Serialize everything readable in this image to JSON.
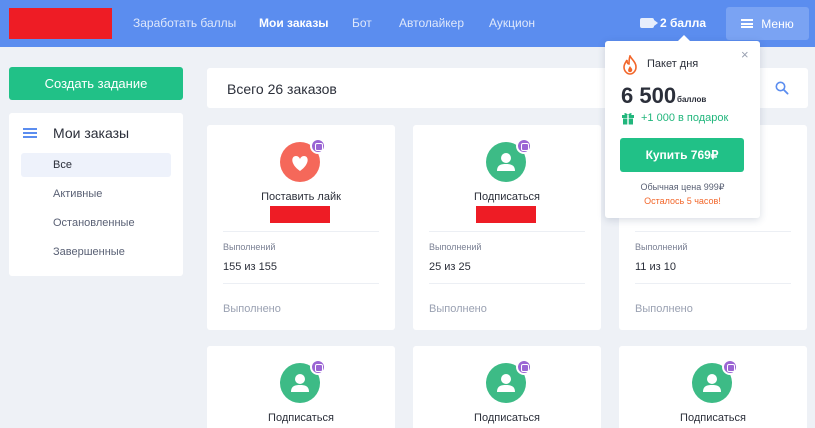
{
  "header": {
    "nav": [
      "Заработать баллы",
      "Мои заказы",
      "Бот",
      "Автолайкер",
      "Аукцион"
    ],
    "points": "2 балла",
    "menu_label": "Меню",
    "accent": "#5b8def"
  },
  "sidebar": {
    "create_label": "Создать задание",
    "title": "Мои заказы",
    "items": [
      "Все",
      "Активные",
      "Остановленные",
      "Завершенные"
    ]
  },
  "main": {
    "total": "Всего 26 заказов",
    "cards": [
      {
        "title": "Поставить лайк",
        "icon": "heart-icon",
        "label": "Выполнений",
        "value": "155 из 155",
        "status": "Выполнено"
      },
      {
        "title": "Подписаться",
        "icon": "user-icon",
        "label": "Выполнений",
        "value": "25 из 25",
        "status": "Выполнено"
      },
      {
        "title": "",
        "icon": "user-icon",
        "label": "Выполнений",
        "value": "11 из 10",
        "status": "Выполнено"
      },
      {
        "title": "Подписаться",
        "icon": "user-icon"
      },
      {
        "title": "Подписаться",
        "icon": "user-icon"
      },
      {
        "title": "Подписаться",
        "icon": "user-icon"
      }
    ]
  },
  "popup": {
    "title": "Пакет дня",
    "amount": "6 500",
    "unit": "баллов",
    "bonus": "+1 000 в подарок",
    "buy_label": "Купить 769₽",
    "old_price": "Обычная цена 999₽",
    "time_left": "Осталось 5 часов!",
    "close": "×",
    "buy_color": "#21c187",
    "warning_color": "#f2662a"
  }
}
